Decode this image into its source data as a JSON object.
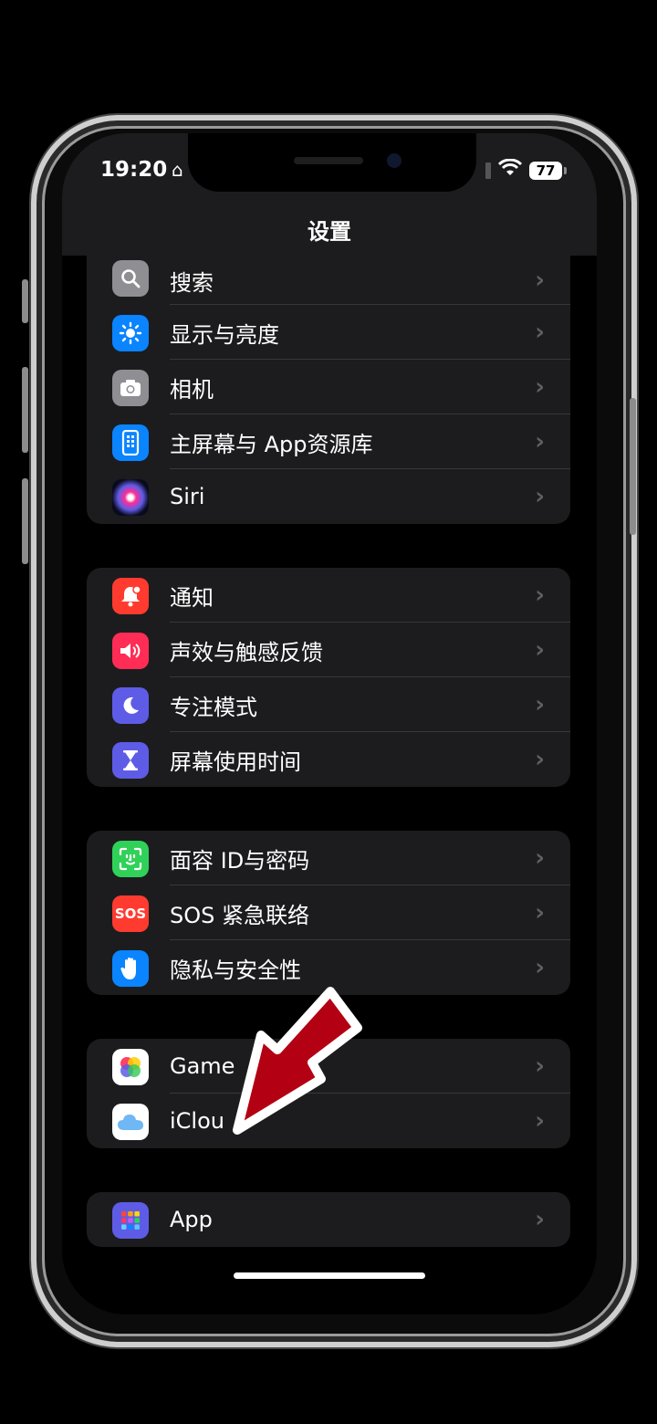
{
  "status_bar": {
    "time": "19:20",
    "battery": "77"
  },
  "nav": {
    "title": "设置"
  },
  "groups": [
    {
      "items": [
        {
          "label": "搜索",
          "icon": "search-icon",
          "color": "#8e8e93"
        },
        {
          "label": "显示与亮度",
          "icon": "sun-icon",
          "color": "#0a84ff"
        },
        {
          "label": "相机",
          "icon": "camera-icon",
          "color": "#8e8e93"
        },
        {
          "label": "主屏幕与 App资源库",
          "icon": "home-screen-icon",
          "color": "#0a84ff"
        },
        {
          "label": "Siri",
          "icon": "siri-icon",
          "color": "#1b1b3a"
        }
      ]
    },
    {
      "items": [
        {
          "label": "通知",
          "icon": "bell-icon",
          "color": "#ff3b30"
        },
        {
          "label": "声效与触感反馈",
          "icon": "speaker-icon",
          "color": "#ff2d55"
        },
        {
          "label": "专注模式",
          "icon": "moon-icon",
          "color": "#5e5ce6"
        },
        {
          "label": "屏幕使用时间",
          "icon": "hourglass-icon",
          "color": "#5e5ce6"
        }
      ]
    },
    {
      "items": [
        {
          "label": "面容 ID与密码",
          "icon": "face-id-icon",
          "color": "#30d158"
        },
        {
          "label": "SOS 紧急联络",
          "icon": "sos-icon",
          "icon_text": "SOS",
          "color": "#ff3b30"
        },
        {
          "label": "隐私与安全性",
          "icon": "hand-icon",
          "color": "#0a84ff"
        }
      ]
    },
    {
      "items": [
        {
          "label": "Game",
          "icon": "game-center-icon",
          "color": "#ffffff"
        },
        {
          "label": "iClou",
          "icon": "icloud-icon",
          "color": "#ffffff"
        }
      ]
    },
    {
      "items": [
        {
          "label": "App",
          "icon": "app-grid-icon",
          "color": "#5e5ce6"
        }
      ]
    }
  ]
}
